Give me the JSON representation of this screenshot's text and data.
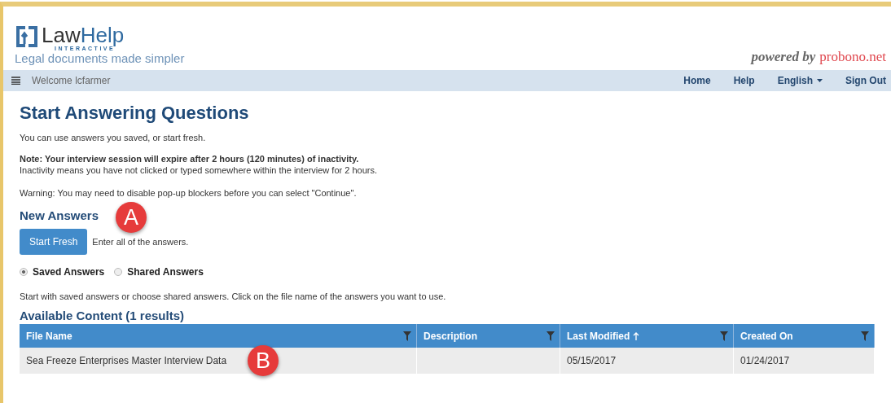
{
  "header": {
    "logo_word_1": "Law",
    "logo_word_2": "Help",
    "logo_sub": "INTERACTIVE",
    "tagline": "Legal documents made simpler",
    "powered_by": "powered by",
    "powered_brand": "probono.net"
  },
  "nav": {
    "welcome": "Welcome lcfarmer",
    "links": [
      {
        "label": "Home",
        "kind": "link"
      },
      {
        "label": "Help",
        "kind": "link"
      },
      {
        "label": "English",
        "kind": "dropdown"
      },
      {
        "label": "Sign Out",
        "kind": "link"
      }
    ]
  },
  "page": {
    "title": "Start Answering Questions",
    "intro": "You can use answers you saved, or start fresh.",
    "note": "Note: Your interview session will expire after 2 hours (120 minutes) of inactivity.",
    "note_detail": "Inactivity means you have not clicked or typed somewhere within the interview for 2 hours.",
    "warning": "Warning: You may need to disable pop-up blockers before you can select \"Continue\"."
  },
  "new_answers": {
    "heading": "New Answers",
    "button": "Start Fresh",
    "hint": "Enter all of the answers.",
    "callout": "A"
  },
  "answer_sources": [
    {
      "label": "Saved Answers",
      "selected": true
    },
    {
      "label": "Shared Answers",
      "selected": false
    }
  ],
  "instructions": "Start with saved answers or choose shared answers. Click on the file name of the answers you want to use.",
  "table": {
    "title": "Available Content (1 results)",
    "callout": "B",
    "columns": [
      {
        "label": "File Name",
        "sorted": false
      },
      {
        "label": "Description",
        "sorted": false
      },
      {
        "label": "Last Modified",
        "sorted": true
      },
      {
        "label": "Created On",
        "sorted": false
      }
    ],
    "rows": [
      [
        "Sea Freeze Enterprises Master Interview Data",
        "",
        "05/15/2017",
        "01/24/2017"
      ]
    ]
  }
}
